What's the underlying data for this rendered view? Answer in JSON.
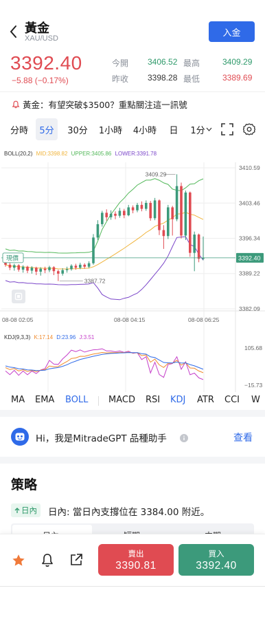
{
  "header": {
    "title": "黃金",
    "symbol": "XAU/USD",
    "deposit_label": "入金"
  },
  "quote": {
    "price": "3392.40",
    "change": "−5.88 (−0.17%)",
    "open_label": "今開",
    "open_value": "3406.52",
    "high_label": "最高",
    "high_value": "3409.29",
    "prev_close_label": "昨收",
    "prev_close_value": "3398.28",
    "low_label": "最低",
    "low_value": "3389.69"
  },
  "news": {
    "headline": "黃金：有望突破$3500？重點關注這一訊號"
  },
  "timeframes": [
    "分時",
    "5分",
    "30分",
    "1小時",
    "4小時",
    "日",
    "1分"
  ],
  "active_timeframe": "5分",
  "boll": {
    "name": "BOLL(20,2)",
    "mid": "MID:3398.82",
    "upper": "UPPER:3405.86",
    "lower": "LOWER:3391.78"
  },
  "chart_data": {
    "type": "candlestick",
    "y_ticks": [
      "3410.59",
      "3403.46",
      "3396.34",
      "3389.22",
      "3382.09"
    ],
    "x_ticks": [
      "08-08 02:05",
      "08-08 04:15",
      "08-08 06:25"
    ],
    "high_marker": "3409.29",
    "low_marker": "3387.72",
    "current_label": "現價",
    "current_price": "3392.40",
    "colors": {
      "up": "#3c9a7b",
      "down": "#e04b52",
      "mid": "#f0b43c",
      "upper": "#53b85a",
      "lower": "#7a45c9"
    },
    "candles": [
      [
        3391.5,
        3391.0,
        3392.2,
        3390.6
      ],
      [
        3391.0,
        3390.4,
        3391.6,
        3389.9
      ],
      [
        3390.4,
        3390.9,
        3391.2,
        3389.8
      ],
      [
        3390.9,
        3390.0,
        3391.1,
        3389.6
      ],
      [
        3390.0,
        3390.6,
        3390.9,
        3389.4
      ],
      [
        3390.6,
        3389.8,
        3390.8,
        3389.3
      ],
      [
        3389.8,
        3390.4,
        3390.7,
        3389.2
      ],
      [
        3390.4,
        3389.6,
        3390.6,
        3388.9
      ],
      [
        3389.6,
        3390.2,
        3390.5,
        3388.8
      ],
      [
        3390.2,
        3389.9,
        3390.6,
        3389.3
      ],
      [
        3389.9,
        3390.5,
        3390.8,
        3389.5
      ],
      [
        3390.5,
        3389.7,
        3390.7,
        3388.9
      ],
      [
        3389.7,
        3389.2,
        3390.0,
        3387.7
      ],
      [
        3389.2,
        3389.9,
        3390.3,
        3388.8
      ],
      [
        3389.9,
        3390.1,
        3390.6,
        3389.4
      ],
      [
        3390.1,
        3390.8,
        3391.1,
        3389.8
      ],
      [
        3390.8,
        3390.4,
        3391.2,
        3390.0
      ],
      [
        3390.4,
        3391.0,
        3391.4,
        3390.1
      ],
      [
        3391.0,
        3390.6,
        3391.3,
        3390.2
      ],
      [
        3390.6,
        3391.3,
        3391.7,
        3390.3
      ],
      [
        3391.3,
        3396.5,
        3397.2,
        3391.0
      ],
      [
        3396.5,
        3399.2,
        3400.0,
        3396.0
      ],
      [
        3399.2,
        3401.5,
        3401.9,
        3398.7
      ],
      [
        3401.5,
        3400.6,
        3402.2,
        3399.9
      ],
      [
        3400.6,
        3401.3,
        3402.0,
        3400.1
      ],
      [
        3401.3,
        3400.9,
        3401.8,
        3400.2
      ],
      [
        3400.9,
        3401.9,
        3402.5,
        3400.5
      ],
      [
        3401.9,
        3401.0,
        3402.3,
        3400.4
      ],
      [
        3401.0,
        3402.6,
        3403.1,
        3400.8
      ],
      [
        3402.6,
        3402.0,
        3403.0,
        3401.4
      ],
      [
        3402.0,
        3403.1,
        3403.5,
        3401.6
      ],
      [
        3403.1,
        3402.3,
        3403.8,
        3401.8
      ],
      [
        3402.3,
        3403.5,
        3404.0,
        3401.9
      ],
      [
        3403.5,
        3400.4,
        3403.9,
        3399.9
      ],
      [
        3400.4,
        3404.0,
        3404.5,
        3400.0
      ],
      [
        3404.0,
        3398.0,
        3404.2,
        3397.0
      ],
      [
        3398.0,
        3396.8,
        3399.0,
        3394.2
      ],
      [
        3396.8,
        3402.6,
        3403.1,
        3396.2
      ],
      [
        3402.6,
        3400.2,
        3402.9,
        3396.9
      ],
      [
        3400.2,
        3406.9,
        3409.29,
        3399.8
      ],
      [
        3406.9,
        3396.9,
        3407.6,
        3396.3
      ],
      [
        3396.9,
        3405.6,
        3406.0,
        3396.0
      ],
      [
        3405.6,
        3393.4,
        3405.8,
        3392.6
      ],
      [
        3393.4,
        3397.1,
        3397.7,
        3389.69
      ],
      [
        3397.1,
        3392.2,
        3397.3,
        3391.5
      ],
      [
        3392.2,
        3392.4,
        3396.7,
        3391.9
      ]
    ]
  },
  "kdj": {
    "name": "KDJ(9,3,3)",
    "k": "K:17.14",
    "d": "D:23.96",
    "j": "J:3.51",
    "y_top": "105.68",
    "y_bottom": "−15.73"
  },
  "indicators": [
    "MA",
    "EMA",
    "BOLL",
    "MACD",
    "RSI",
    "KDJ",
    "ATR",
    "CCI",
    "W"
  ],
  "active_indicators": [
    "BOLL",
    "KDJ"
  ],
  "assistant": {
    "prefix": "Hi，我是",
    "name": "MitradeGPT 品種助手",
    "link": "查看"
  },
  "strategy": {
    "title": "策略",
    "tag": "日內",
    "text": "日內: 當日內支撐位在 3384.00 附近。",
    "tabs": [
      "日內",
      "短期",
      "中期"
    ]
  },
  "trade": {
    "sell_label": "賣出",
    "sell_price": "3390.81",
    "buy_label": "買入",
    "buy_price": "3392.40"
  }
}
